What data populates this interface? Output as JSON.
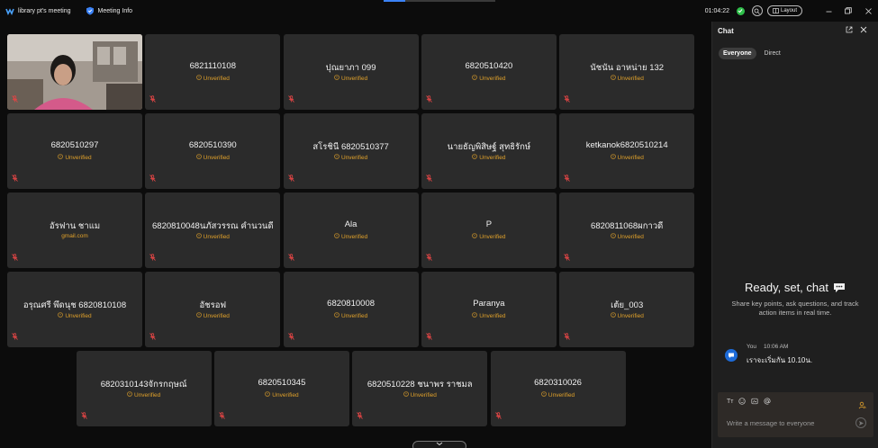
{
  "titlebar": {
    "meeting_name": "library pt's meeting",
    "meeting_info": "Meeting Info",
    "timer": "01:04:22",
    "layout_label": "Layout"
  },
  "participants": [
    {
      "name": "",
      "status": "",
      "video": true
    },
    {
      "name": "6821110108",
      "status": "Unverified"
    },
    {
      "name": "ปุณยาภา 099",
      "status": "Unverified"
    },
    {
      "name": "6820510420",
      "status": "Unverified"
    },
    {
      "name": "นัชนัน อาหน่าย 132",
      "status": "Unverified"
    },
    {
      "name": "6820510297",
      "status": "Unverified"
    },
    {
      "name": "6820510390",
      "status": "Unverified"
    },
    {
      "name": "สโรชินี 6820510377",
      "status": "Unverified"
    },
    {
      "name": "นายธัญพิสิษฐ์ สุทธิรักษ์",
      "status": "Unverified"
    },
    {
      "name": "ketkanok6820510214",
      "status": "Unverified"
    },
    {
      "name": "อัรฟาน ชาแม",
      "status": "gmail.com"
    },
    {
      "name": "6820810048นภัสวรรณ คำนวนดี",
      "status": "Unverified"
    },
    {
      "name": "Ala",
      "status": "Unverified"
    },
    {
      "name": "P",
      "status": "Unverified"
    },
    {
      "name": "6820811068ผกาวดี",
      "status": "Unverified"
    },
    {
      "name": "อรุณศรี พึดนุช 6820810108",
      "status": "Unverified"
    },
    {
      "name": "อัชรอฟ",
      "status": "Unverified"
    },
    {
      "name": "6820810008",
      "status": "Unverified"
    },
    {
      "name": "Paranya",
      "status": "Unverified"
    },
    {
      "name": "เต้ย_003",
      "status": "Unverified"
    },
    {
      "name": "6820310143จักรกฤษณ์",
      "status": "Unverified"
    },
    {
      "name": "6820510345",
      "status": "Unverified"
    },
    {
      "name": "6820510228 ชนาพร ราชมล",
      "status": "Unverified"
    },
    {
      "name": "6820310026",
      "status": "Unverified"
    }
  ],
  "chat": {
    "title": "Chat",
    "tabs": [
      "Everyone",
      "Direct"
    ],
    "empty_title": "Ready, set, chat",
    "empty_sub": "Share key points, ask questions, and track action items in real time.",
    "message": {
      "sender": "You",
      "time": "10:06 AM",
      "text": "เราจะเริ่มกัน 10.10น."
    },
    "placeholder": "Write a message to everyone",
    "format_label": "Tт"
  },
  "colors": {
    "tile_bg": "#2b2b2b",
    "unverified": "#e0a12b",
    "accent": "#1d6bd8",
    "mic_muted": "#e04545"
  }
}
